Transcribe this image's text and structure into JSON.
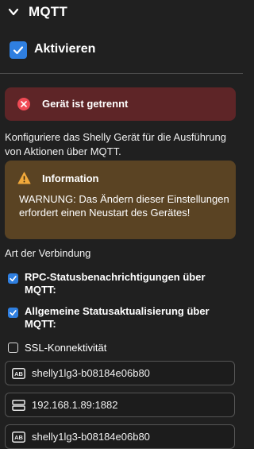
{
  "header": {
    "title": "MQTT",
    "chevron_icon": "chevron-down-icon"
  },
  "enable": {
    "label": "Aktivieren",
    "checked": true
  },
  "error_alert": {
    "icon": "error-x-icon",
    "text": "Gerät ist getrennt",
    "color": "#5e2527"
  },
  "description": "Konfiguriere das Shelly Gerät für die Ausführung von Aktionen über MQTT.",
  "info_alert": {
    "icon": "warning-triangle-icon",
    "title": "Information",
    "text": "WARNUNG: Das Ändern dieser Einstellungen erfordert einen Neustart des Gerätes!",
    "color": "#5a4323"
  },
  "connection": {
    "label": "Art der Verbindung",
    "options": [
      {
        "label": "RPC-Statusbenachrichtigungen über MQTT:",
        "checked": true
      },
      {
        "label": "Allgemeine Statusaktualisierung über MQTT:",
        "checked": true
      },
      {
        "label": "SSL-Konnektivität",
        "checked": false
      }
    ]
  },
  "fields": [
    {
      "icon": "text-field-icon",
      "value": "shelly1lg3-b08184e06b80"
    },
    {
      "icon": "server-icon",
      "value": "192.168.1.89:1882"
    },
    {
      "icon": "text-field-icon",
      "value": "shelly1lg3-b08184e06b80"
    }
  ],
  "colors": {
    "accent": "#2f7fe0",
    "background": "#202020"
  }
}
